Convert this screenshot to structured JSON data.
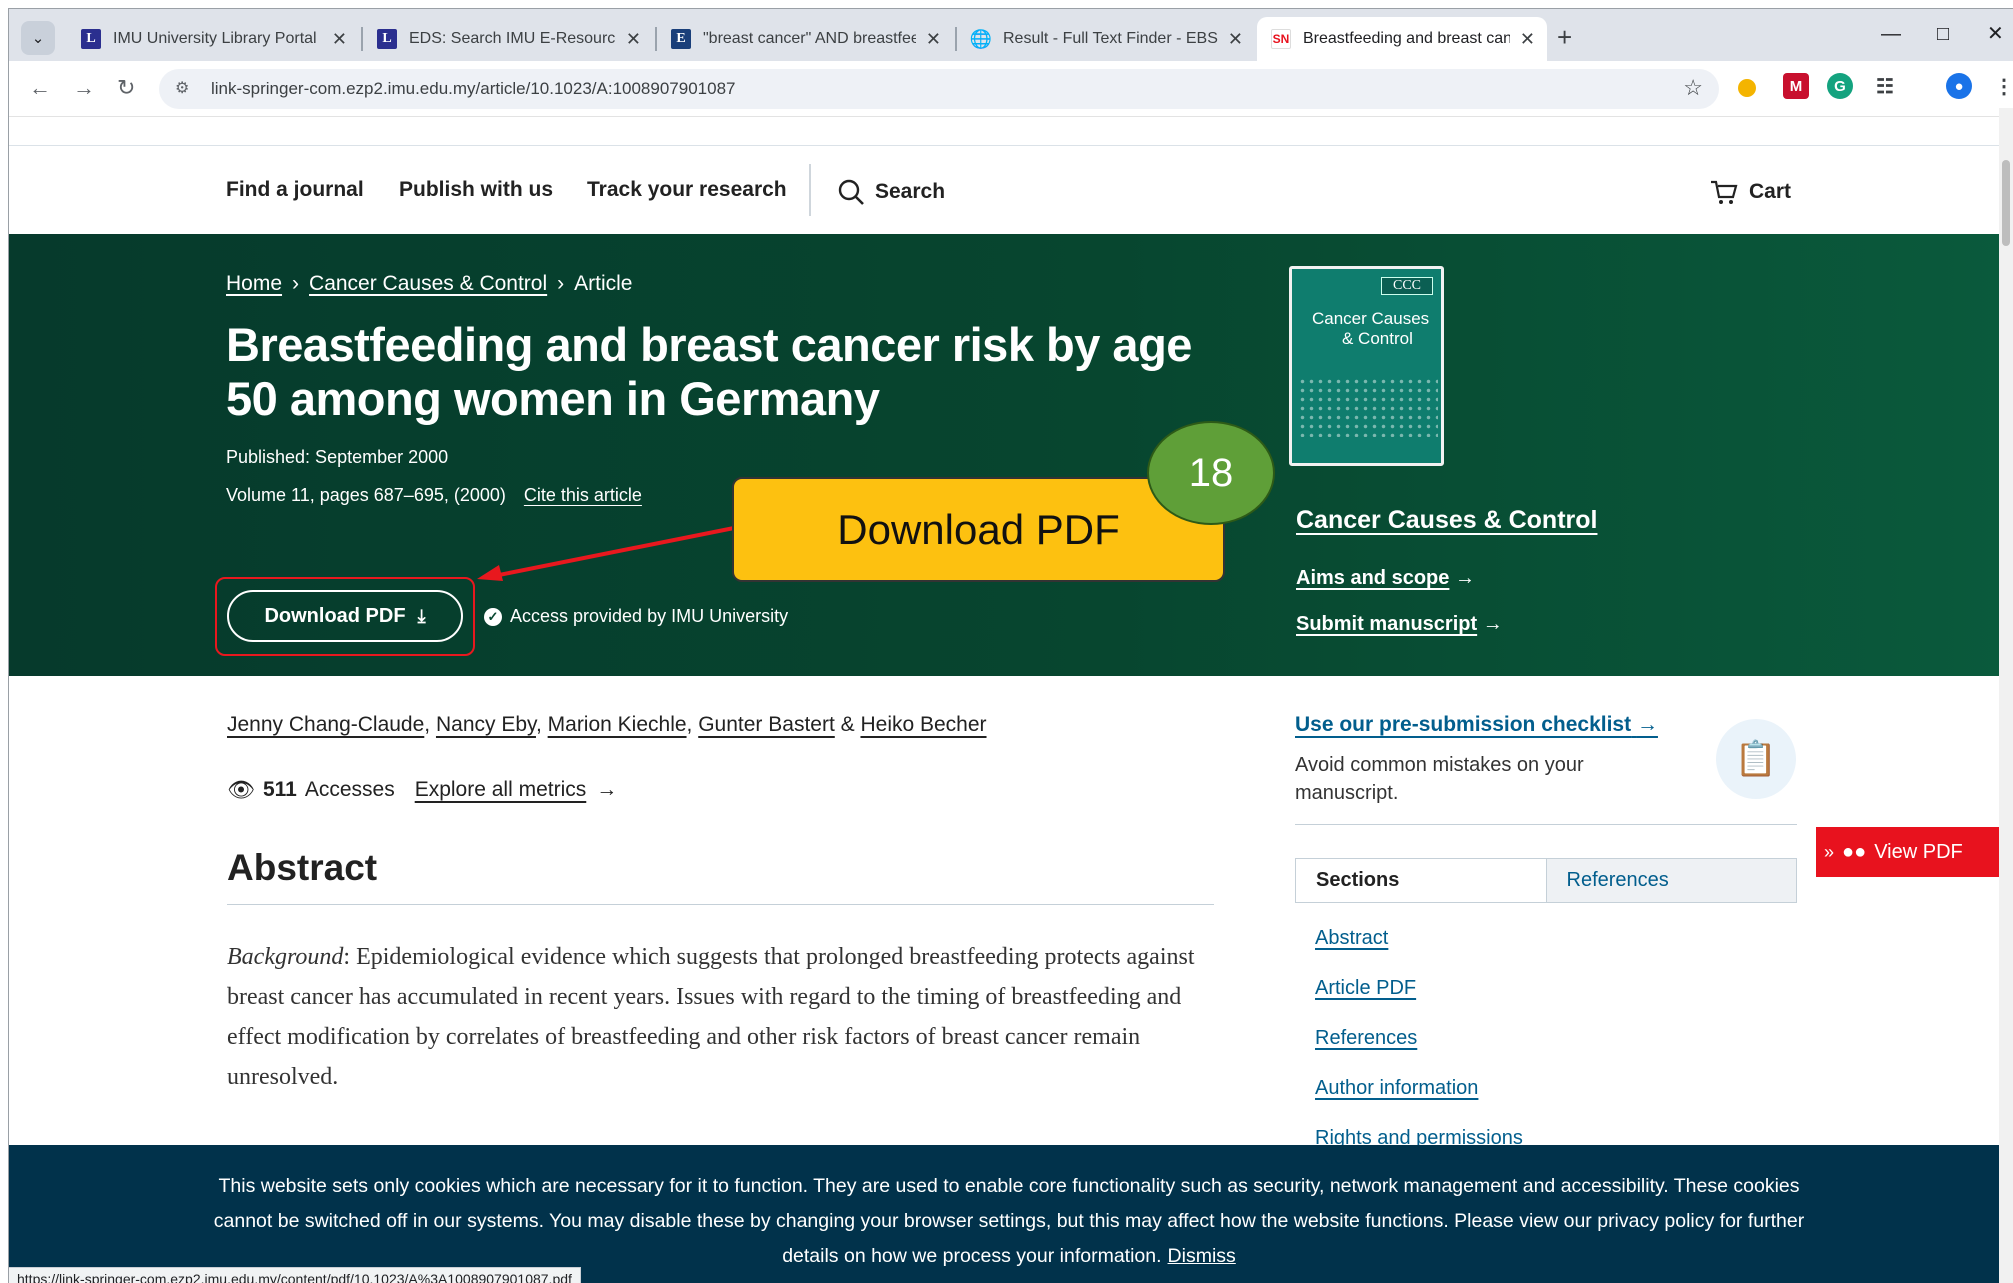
{
  "browser": {
    "tabs": [
      {
        "title": "IMU University Library Portal",
        "favicon": "L"
      },
      {
        "title": "EDS: Search IMU E-Resources C",
        "favicon": "L"
      },
      {
        "title": "\"breast cancer\" AND breastfeed",
        "favicon": "E"
      },
      {
        "title": "Result - Full Text Finder - EBSCO",
        "favicon": "globe-icon"
      },
      {
        "title": "Breastfeeding and breast cance",
        "favicon": "SN"
      }
    ],
    "url": "link-springer-com.ezp2.imu.edu.my/article/10.1023/A:1008907901087",
    "status_url": "https://link-springer-com.ezp2.imu.edu.my/content/pdf/10.1023/A%3A1008907901087.pdf"
  },
  "header": {
    "nav": [
      "Find a journal",
      "Publish with us",
      "Track your research"
    ],
    "search_label": "Search",
    "cart_label": "Cart"
  },
  "hero": {
    "breadcrumb": {
      "home": "Home",
      "journal": "Cancer Causes & Control",
      "current": "Article"
    },
    "title": "Breastfeeding and breast cancer risk by age 50 among women in Germany",
    "published": "Published: September 2000",
    "volume": "Volume 11, pages 687–695, (2000)",
    "cite": "Cite this article",
    "download_label": "Download PDF",
    "access": "Access provided by IMU University",
    "cover": {
      "abbr": "CCC",
      "name_line1": "Cancer Causes",
      "name_line2": "& Control"
    },
    "journal_name": "Cancer Causes & Control",
    "aims": "Aims and scope",
    "submit": "Submit manuscript"
  },
  "annotation": {
    "callout": "Download PDF",
    "step": "18"
  },
  "article": {
    "authors": [
      "Jenny Chang-Claude",
      "Nancy Eby",
      "Marion Kiechle",
      "Gunter Bastert",
      "Heiko Becher"
    ],
    "accesses_count": "511",
    "accesses_label": "Accesses",
    "explore": "Explore all metrics",
    "abstract_heading": "Abstract",
    "abstract_label": "Background",
    "abstract_text": ": Epidemiological evidence which suggests that prolonged breastfeeding protects against breast cancer has accumulated in recent years. Issues with regard to the timing of breastfeeding and effect modification by correlates of breastfeeding and other risk factors of breast cancer remain unresolved."
  },
  "sidebar": {
    "checklist_link": "Use our pre-submission checklist",
    "checklist_text": "Avoid common mistakes on your manuscript.",
    "tabs": [
      "Sections",
      "References"
    ],
    "sections": [
      "Abstract",
      "Article PDF",
      "References",
      "Author information",
      "Rights and permissions"
    ]
  },
  "view_pdf": "View PDF",
  "cookie": {
    "text": "This website sets only cookies which are necessary for it to function. They are used to enable core functionality such as security, network management and accessibility. These cookies cannot be switched off in our systems. You may disable these by changing your browser settings, but this may affect how the website functions. Please view our privacy policy for further details on how we process your information.",
    "dismiss": "Dismiss"
  },
  "colors": {
    "hero_bg": "#063a2c",
    "link_blue": "#025e8d",
    "callout_yellow": "#fdc110",
    "badge_green": "#5f9f38",
    "highlight_red": "#e8181e",
    "cookie_bg": "#01324b",
    "view_pdf_red": "#e8121e"
  }
}
